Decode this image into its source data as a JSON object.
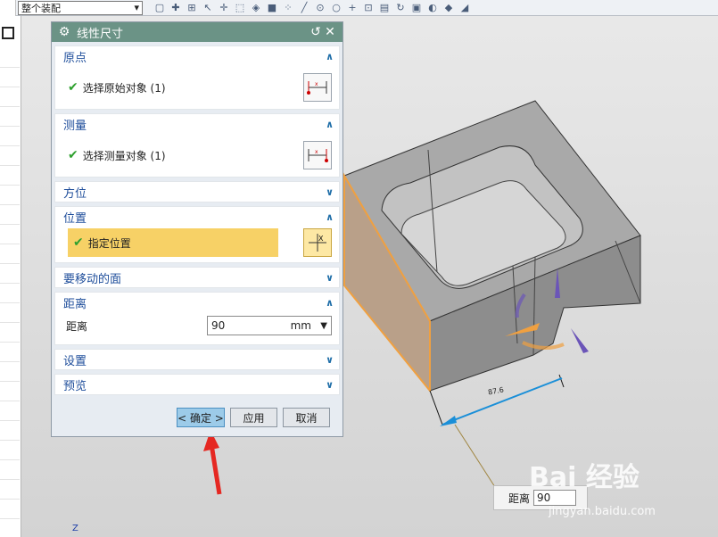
{
  "toolbar": {
    "assembly_select": "整个装配"
  },
  "dialog": {
    "title": "线性尺寸",
    "sections": {
      "origin": {
        "title": "原点",
        "text": "选择原始对象 (1)"
      },
      "measure": {
        "title": "测量",
        "text": "选择测量对象 (1)"
      },
      "orientation": {
        "title": "方位"
      },
      "location": {
        "title": "位置",
        "text": "指定位置"
      },
      "faces": {
        "title": "要移动的面"
      },
      "distance": {
        "title": "距离",
        "label": "距离",
        "value": "90",
        "unit": "mm"
      },
      "settings": {
        "title": "设置"
      },
      "preview": {
        "title": "预览"
      }
    },
    "buttons": {
      "ok": "< 确定 >",
      "apply": "应用",
      "cancel": "取消"
    }
  },
  "viewport": {
    "dimension_text": "87.6",
    "popup_label": "距离",
    "popup_value": "90",
    "axis_label": "Z",
    "watermark": "Bai 经验",
    "watermark_url": "jingyan.baidu.com"
  },
  "colors": {
    "title_bar": "#6b9386",
    "section_title": "#1f4e9b",
    "highlight": "#f7d166",
    "annotation": "#e52822",
    "selected_face": "#f0a040",
    "dimension_line": "#1a8fd8"
  }
}
